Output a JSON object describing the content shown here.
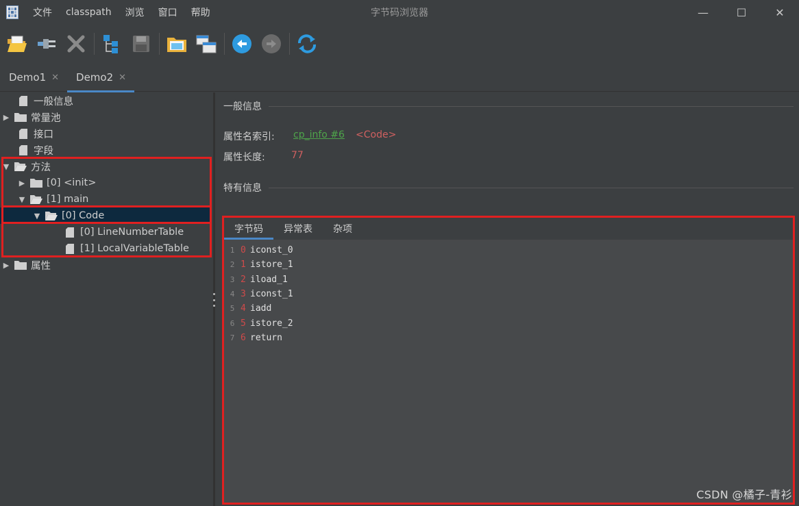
{
  "window": {
    "title": "字节码浏览器",
    "menu": [
      "文件",
      "classpath",
      "浏览",
      "窗口",
      "帮助"
    ],
    "controls": {
      "minimize": "—",
      "maximize": "☐",
      "close": "✕"
    }
  },
  "toolbar": {
    "buttons": [
      {
        "name": "open-file-icon"
      },
      {
        "name": "connect-icon"
      },
      {
        "name": "close-file-icon"
      },
      {
        "name": "tree-icon"
      },
      {
        "name": "save-icon"
      },
      {
        "name": "open-folder-icon"
      },
      {
        "name": "window-icon"
      },
      {
        "name": "back-icon"
      },
      {
        "name": "forward-icon"
      },
      {
        "name": "refresh-icon"
      }
    ]
  },
  "file_tabs": [
    {
      "label": "Demo1",
      "close": "✕",
      "active": false
    },
    {
      "label": "Demo2",
      "close": "✕",
      "active": true
    }
  ],
  "tree": {
    "items": [
      {
        "label": "一般信息",
        "expander": ""
      },
      {
        "label": "常量池",
        "expander": "▶"
      },
      {
        "label": "接口",
        "expander": ""
      },
      {
        "label": "字段",
        "expander": ""
      },
      {
        "label": "方法",
        "expander": "▼"
      },
      {
        "label": "[0] <init>",
        "expander": "▶"
      },
      {
        "label": "[1] main",
        "expander": "▼"
      },
      {
        "label": "[0] Code",
        "expander": "▼"
      },
      {
        "label": "[0] LineNumberTable",
        "expander": ""
      },
      {
        "label": "[1] LocalVariableTable",
        "expander": ""
      },
      {
        "label": "属性",
        "expander": "▶"
      }
    ]
  },
  "detail": {
    "general_title": "一般信息",
    "name_index_label": "属性名索引:",
    "name_index_link": "cp_info #6",
    "name_index_value": "<Code>",
    "length_label": "属性长度:",
    "length_value": "77",
    "specific_title": "特有信息",
    "tabs": [
      "字节码",
      "异常表",
      "杂项"
    ],
    "code": [
      {
        "line": "1",
        "offset": "0",
        "instr": "iconst_0"
      },
      {
        "line": "2",
        "offset": "1",
        "instr": "istore_1"
      },
      {
        "line": "3",
        "offset": "2",
        "instr": "iload_1"
      },
      {
        "line": "4",
        "offset": "3",
        "instr": "iconst_1"
      },
      {
        "line": "5",
        "offset": "4",
        "instr": "iadd"
      },
      {
        "line": "6",
        "offset": "5",
        "instr": "istore_2"
      },
      {
        "line": "7",
        "offset": "6",
        "instr": "return"
      }
    ]
  },
  "watermark": "CSDN @橘子-青衫",
  "colors": {
    "background": "#3c3f41",
    "selection": "#0d293e",
    "accent": "#4a88c7",
    "highlight_box": "#e02020",
    "link": "#4ea54a",
    "value": "#d06060"
  }
}
